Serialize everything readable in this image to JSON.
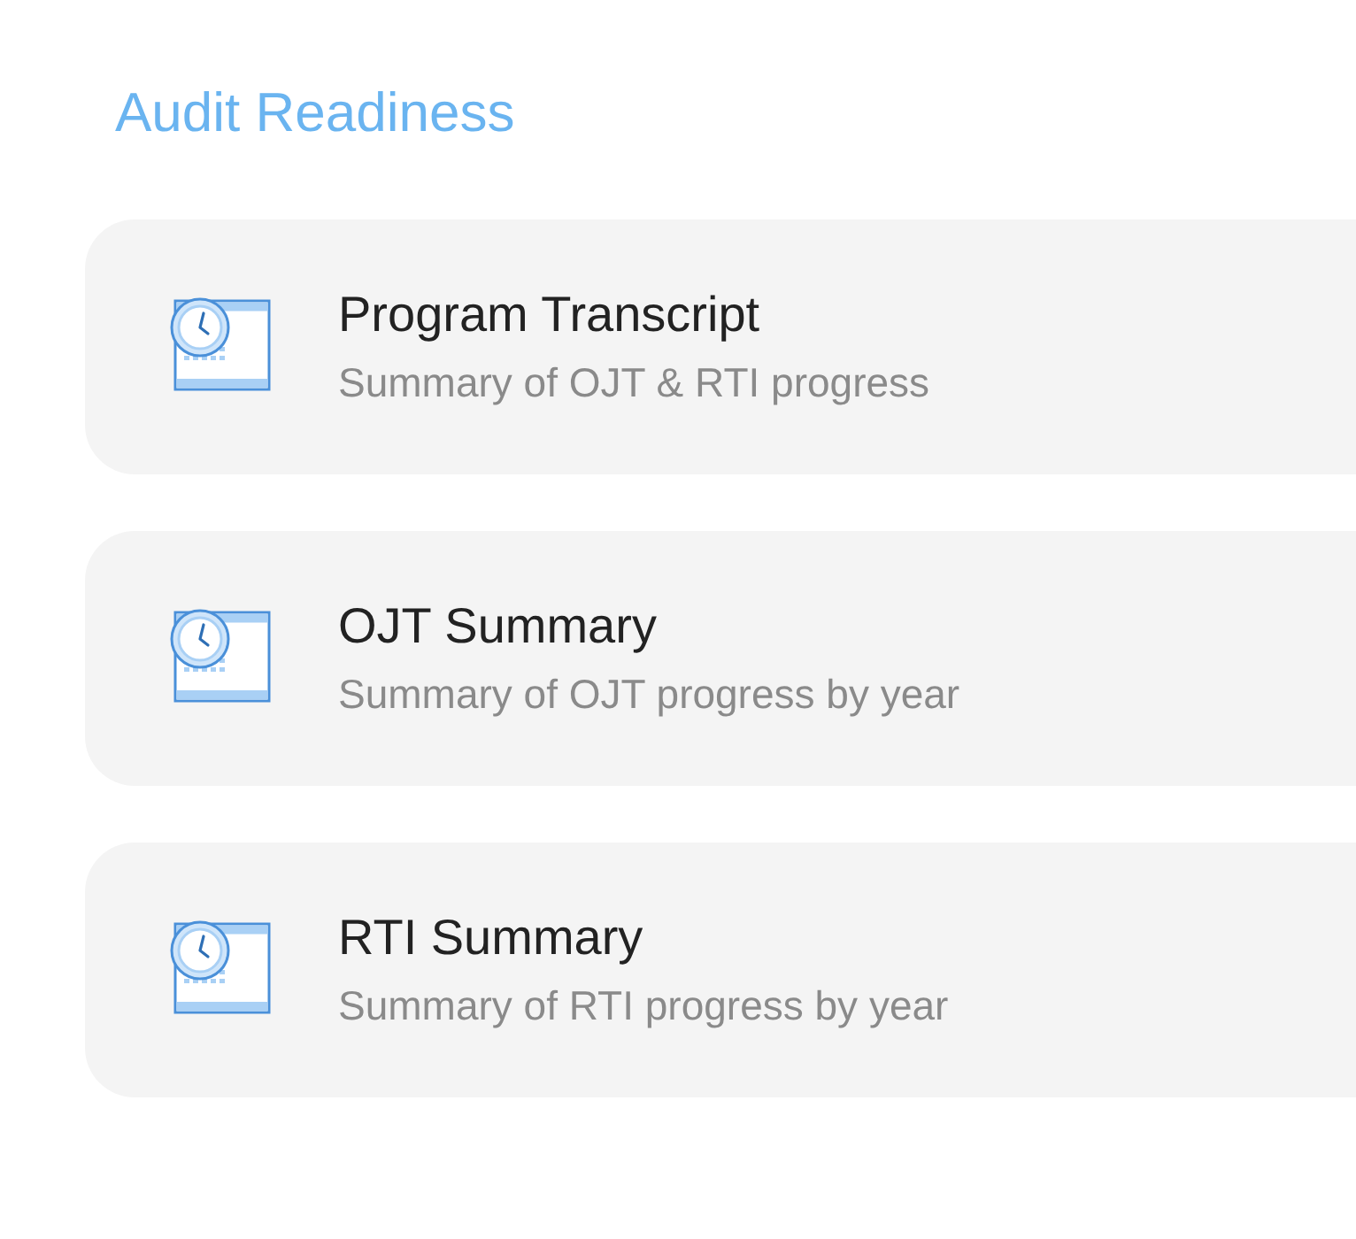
{
  "heading": "Audit Readiness",
  "reports": [
    {
      "title": "Program Transcript",
      "description": "Summary of OJT & RTI progress"
    },
    {
      "title": "OJT Summary",
      "description": "Summary of OJT progress by year"
    },
    {
      "title": "RTI Summary",
      "description": "Summary of RTI progress by year"
    }
  ]
}
